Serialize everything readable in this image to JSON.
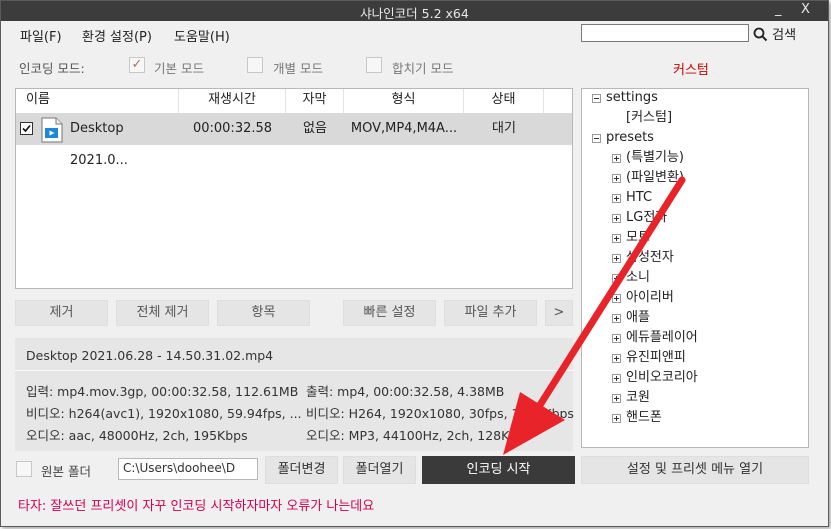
{
  "window": {
    "title": "샤나인코더  5.2  x64",
    "minimize": "_",
    "close": "X"
  },
  "menu": {
    "file": "파일(F)",
    "settings": "환경 설정(P)",
    "help": "도움말(H)"
  },
  "search": {
    "value": "",
    "button_label": "검색"
  },
  "modes": {
    "label": "인코딩 모드:",
    "basic": {
      "label": "기본 모드",
      "check": "✓"
    },
    "individual": {
      "label": "개별 모드"
    },
    "merge": {
      "label": "합치기 모드"
    }
  },
  "custom_title": "커스텀",
  "table": {
    "columns": [
      "이름",
      "재생시간",
      "자막",
      "형식",
      "상태"
    ],
    "rows": [
      {
        "name": "Desktop 2021.0...",
        "duration": "00:00:32.58",
        "subtitle": "없음",
        "format": "MOV,MP4,M4A...",
        "status": "대기"
      }
    ]
  },
  "buttons": {
    "remove": "제거",
    "remove_all": "전체 제거",
    "item": "항목",
    "quick_settings": "빠른 설정",
    "add_file": "파일 추가",
    "more": ">",
    "change_folder": "폴더변경",
    "open_folder": "폴더열기",
    "start_encoding": "인코딩 시작",
    "settings_menu": "설정 및 프리셋 메뉴 열기"
  },
  "info": {
    "filename": "Desktop 2021.06.28 - 14.50.31.02.mp4",
    "input": "입력: mp4.mov.3gp, 00:00:32.58, 112.61MB",
    "video_in": "비디오: h264(avc1), 1920x1080, 59.94fps, ...",
    "audio_in": "오디오: aac, 48000Hz, 2ch, 195Kbps",
    "output": "출력: mp4, 00:00:32.58, 4.38MB",
    "video_out": "비디오: H264, 1920x1080, 30fps, 1000Kbps",
    "audio_out": "오디오: MP3, 44100Hz, 2ch, 128Kbps"
  },
  "tree": {
    "settings": "settings",
    "custom": "[커스텀]",
    "presets": "presets",
    "items": [
      "(특별기능)",
      "(파일변환)",
      "HTC",
      "LG전자",
      "모토",
      "삼성전자",
      "소니",
      "아이리버",
      "애플",
      "에듀플레이어",
      "유진피앤피",
      "인비오코리아",
      "코원",
      "핸드폰"
    ]
  },
  "bottom": {
    "original_folder": "원본 폴더",
    "path": "C:\\Users\\doohee\\D"
  },
  "status_text": "타자: 잘쓰던 프리셋이 자꾸 인코딩 시작하자마자 오류가 나는데요",
  "colors": {
    "titlebar": "#3c3c3c",
    "encode_button": "#3a3a3a",
    "accent_red": "#d00000",
    "status_pink": "#d4004f",
    "arrow": "#e8232a"
  }
}
